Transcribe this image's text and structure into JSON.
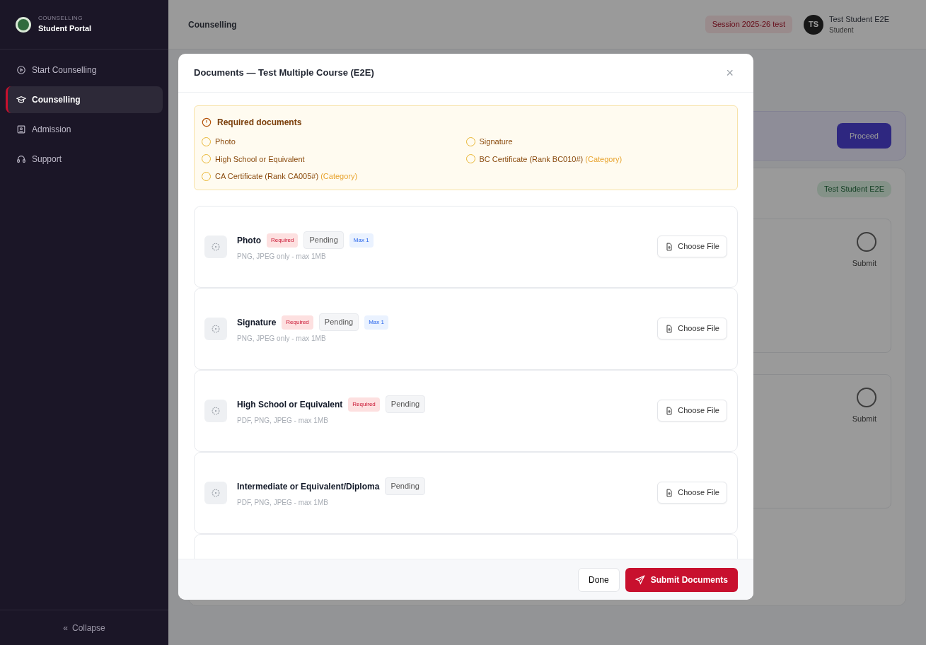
{
  "sidebar": {
    "kicker": "COUNSELLING",
    "title": "Student Portal",
    "items": [
      {
        "label": "Start Counselling",
        "selected": false
      },
      {
        "label": "Counselling",
        "selected": true
      },
      {
        "label": "Admission",
        "selected": false
      },
      {
        "label": "Support",
        "selected": false
      }
    ],
    "collapse": {
      "icon": "«",
      "label": "Collapse"
    }
  },
  "background": {
    "header_title": "Counselling",
    "session_badge": "Session 2025-26 test",
    "user": {
      "initials": "TS",
      "name": "Test Student E2E",
      "role": "Student"
    },
    "proceed_button": "Proceed",
    "student_badge": "Test Student E2E",
    "steps": [
      {
        "label": "Submit"
      },
      {
        "label": "Submit"
      }
    ]
  },
  "modal": {
    "title": "Documents — Test Multiple Course (E2E)",
    "close": "×",
    "notice": {
      "title": "Required documents",
      "items": [
        {
          "label": "Photo"
        },
        {
          "label": "Signature"
        },
        {
          "label": "High School or Equivalent"
        },
        {
          "label": "BC Certificate (Rank BC010#)",
          "note": "(Category)"
        },
        {
          "label": "CA Certificate (Rank CA005#)",
          "note": "(Category)"
        }
      ]
    },
    "documents": [
      {
        "name": "Photo",
        "hint": "PNG, JPEG only - max 1MB",
        "button": "Choose File",
        "badges": [
          {
            "kind": "required",
            "text": "Required"
          },
          {
            "kind": "status",
            "text": "Pending"
          },
          {
            "kind": "limit",
            "text": "Max 1"
          }
        ]
      },
      {
        "name": "Signature",
        "hint": "PNG, JPEG only - max 1MB",
        "button": "Choose File",
        "badges": [
          {
            "kind": "required",
            "text": "Required"
          },
          {
            "kind": "status",
            "text": "Pending"
          },
          {
            "kind": "limit",
            "text": "Max 1"
          }
        ]
      },
      {
        "name": "High School or Equivalent",
        "hint": "PDF, PNG, JPEG - max 1MB",
        "button": "Choose File",
        "badges": [
          {
            "kind": "required",
            "text": "Required"
          },
          {
            "kind": "status",
            "text": "Pending"
          }
        ]
      },
      {
        "name": "Intermediate or Equivalent/Diploma",
        "hint": "PDF, PNG, JPEG - max 1MB",
        "button": "Choose File",
        "badges": [
          {
            "kind": "status",
            "text": "Pending"
          }
        ]
      }
    ],
    "done_button": "Done",
    "submit_button": "Submit Documents"
  }
}
